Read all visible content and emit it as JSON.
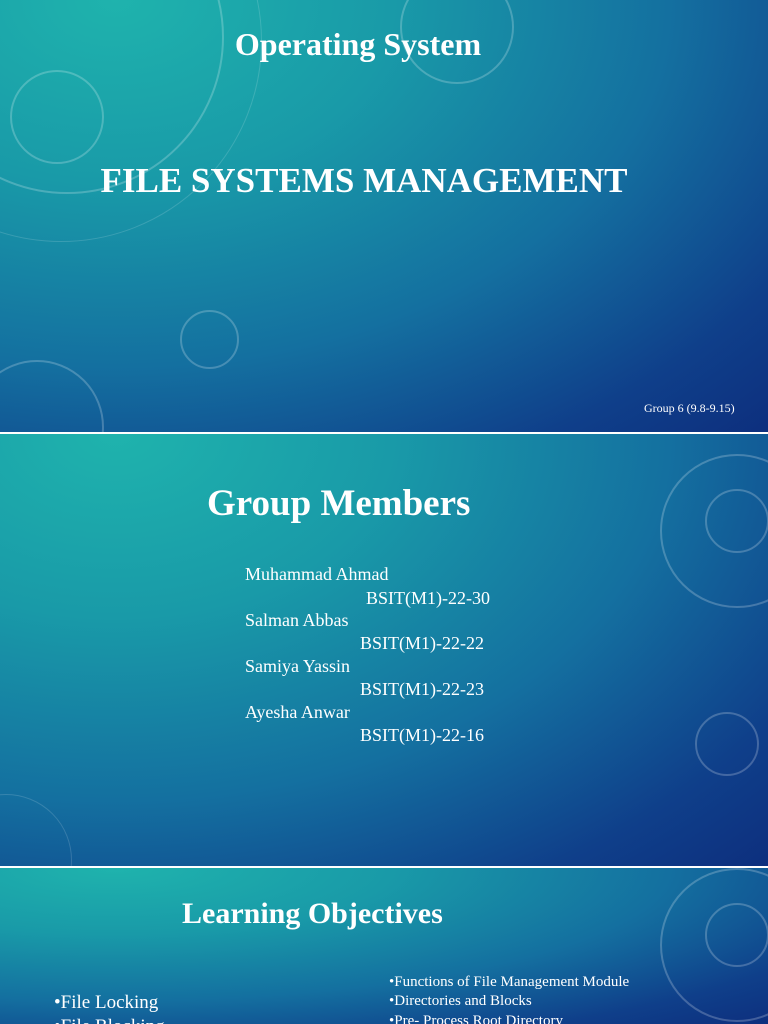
{
  "slide1": {
    "subtitle": "Operating System",
    "title": "FILE SYSTEMS MANAGEMENT",
    "group": "Group 6 (9.8-9.15)"
  },
  "slide2": {
    "title": "Group Members",
    "members": [
      {
        "name": "Muhammad Ahmad",
        "id": "BSIT(M1)-22-30"
      },
      {
        "name": "Salman Abbas",
        "id": "BSIT(M1)-22-22"
      },
      {
        "name": "Samiya Yassin",
        "id": "BSIT(M1)-22-23"
      },
      {
        "name": "Ayesha Anwar",
        "id": "BSIT(M1)-22-16"
      }
    ]
  },
  "slide3": {
    "title": "Learning Objectives",
    "left": [
      "•File Locking",
      "•File Blocking"
    ],
    "right": [
      "•Functions of File Management Module",
      "•Directories and Blocks",
      "•Pre- Process Root Directory"
    ]
  }
}
